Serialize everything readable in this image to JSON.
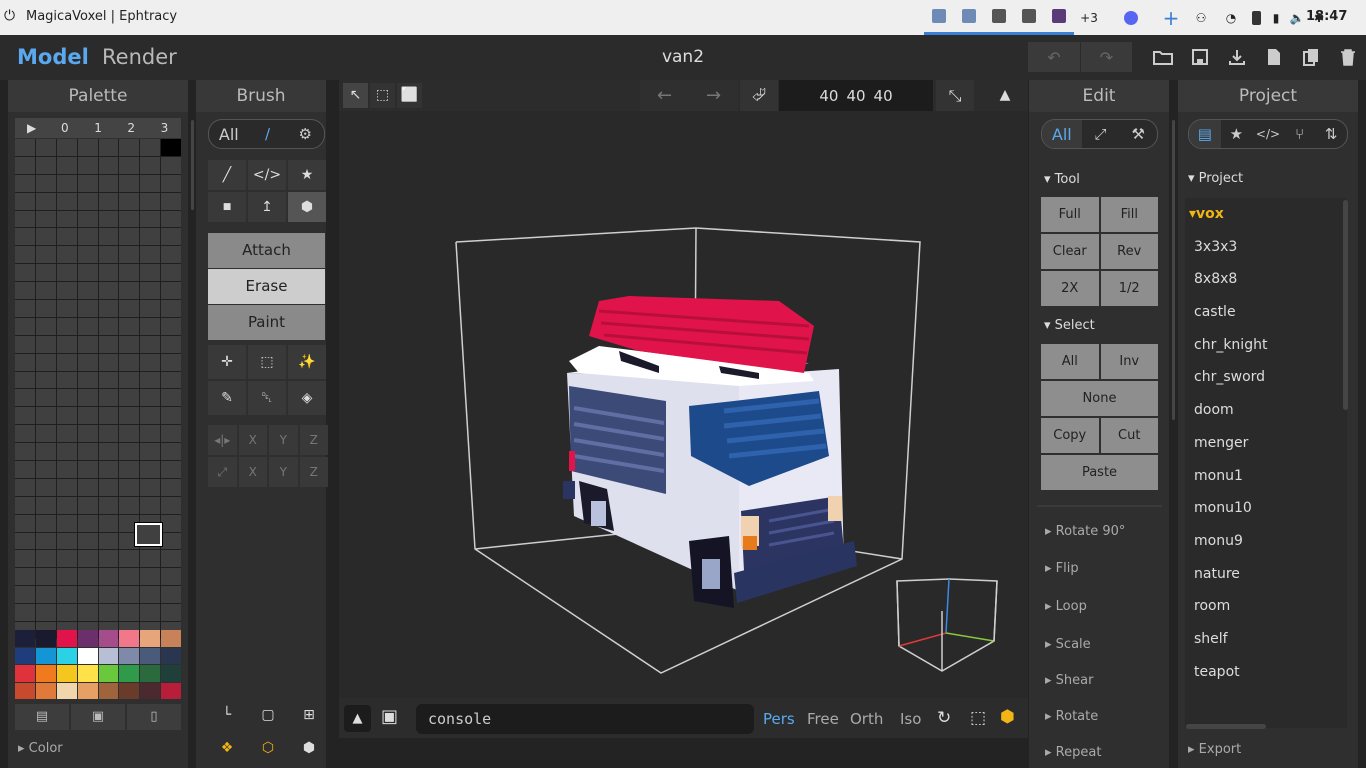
{
  "os": {
    "window_title": "MagicaVoxel | Ephtracy",
    "tray_more": "+3",
    "clock": "18:47"
  },
  "app": {
    "tabs": [
      "Model",
      "Render"
    ],
    "filename": "van2"
  },
  "palette": {
    "title": "Palette",
    "tabs": [
      "▶",
      "0",
      "1",
      "2",
      "3"
    ],
    "colors": [
      "#1c1f3a",
      "#1a1a2e",
      "#e0144a",
      "#6b2f6b",
      "#a54c8a",
      "#f0788a",
      "#e6a57a",
      "#c7825a",
      "#1f3d7a",
      "#1495d6",
      "#2bd2e6",
      "#ffffff",
      "#b7bfd6",
      "#7f8aa8",
      "#4a5a7a",
      "#2a3550",
      "#e0323c",
      "#f07a1e",
      "#f5c61e",
      "#ffe14a",
      "#6ac83c",
      "#2e9a4a",
      "#2a6a3c",
      "#1e3f3a",
      "#c84a2e",
      "#e07a3a",
      "#f0d6aa",
      "#e6a063",
      "#a0643c",
      "#6a3a2a",
      "#4a2a2e",
      "#b81e3a"
    ],
    "footer": "Color"
  },
  "brush": {
    "title": "Brush",
    "seg_label": "All",
    "modes": [
      "Attach",
      "Erase",
      "Paint"
    ],
    "axis_labels": [
      "X",
      "Y",
      "Z"
    ]
  },
  "viewport": {
    "dims": [
      "40",
      "40",
      "40"
    ],
    "console_placeholder": "console",
    "view_modes": [
      "Pers",
      "Free",
      "Orth",
      "Iso"
    ]
  },
  "edit": {
    "title": "Edit",
    "seg_label": "All",
    "tool_label": "Tool",
    "tool_buttons": [
      "Full",
      "Fill",
      "Clear",
      "Rev",
      "2X",
      "1/2"
    ],
    "select_label": "Select",
    "select_buttons": [
      "All",
      "Inv",
      "None",
      "Copy",
      "Cut",
      "Paste"
    ],
    "folds": [
      "Rotate 90°",
      "Flip",
      "Loop",
      "Scale",
      "Shear",
      "Rotate",
      "Repeat"
    ]
  },
  "project": {
    "title": "Project",
    "section": "Project",
    "folder": "vox",
    "items": [
      "3x3x3",
      "8x8x8",
      "castle",
      "chr_knight",
      "chr_sword",
      "doom",
      "menger",
      "monu1",
      "monu10",
      "monu9",
      "nature",
      "room",
      "shelf",
      "teapot"
    ],
    "footer": "Export"
  },
  "colors": {
    "accent": "#5aa9f0",
    "folder": "#f1b515"
  }
}
